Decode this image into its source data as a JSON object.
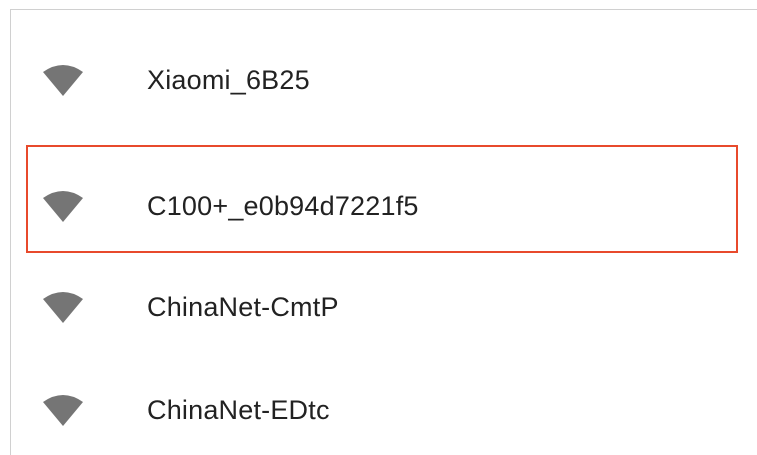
{
  "wifi_networks": [
    {
      "ssid": "Xiaomi_6B25",
      "icon": "wifi-signal-icon"
    },
    {
      "ssid": "C100+_e0b94d7221f5",
      "icon": "wifi-signal-icon"
    },
    {
      "ssid": "ChinaNet-CmtP",
      "icon": "wifi-signal-icon"
    },
    {
      "ssid": "ChinaNet-EDtc",
      "icon": "wifi-signal-icon"
    }
  ],
  "colors": {
    "icon": "#757575",
    "text": "#222222",
    "highlight": "#e84a2c",
    "background": "#ffffff"
  }
}
